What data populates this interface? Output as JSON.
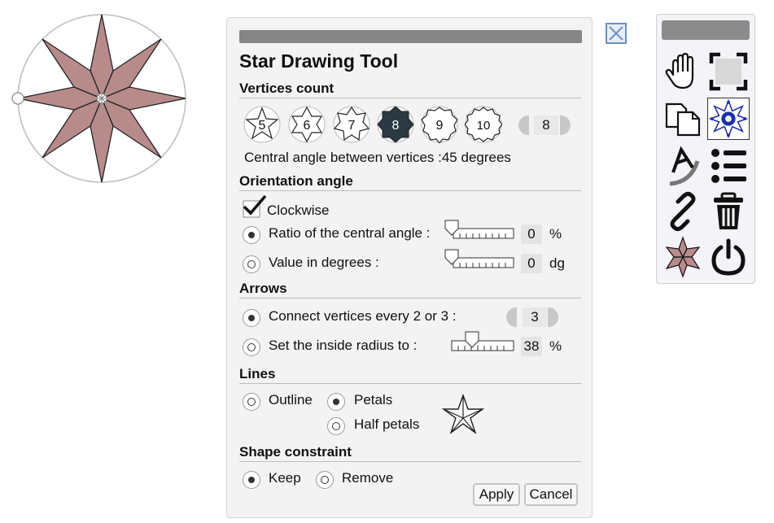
{
  "dialog": {
    "title": "Star Drawing Tool",
    "vertices": {
      "heading": "Vertices count",
      "options": [
        "5",
        "6",
        "7",
        "8",
        "9",
        "10"
      ],
      "selected": "8",
      "spinner_value": "8",
      "central_angle_text": "Central angle between vertices :45 degrees"
    },
    "orientation": {
      "heading": "Orientation angle",
      "clockwise_label": "Clockwise",
      "clockwise_checked": true,
      "ratio_label": "Ratio of the central angle :",
      "ratio_value": "0",
      "ratio_unit": "%",
      "degrees_label": "Value in degrees :",
      "degrees_value": "0",
      "degrees_unit": "dg",
      "selected": "ratio"
    },
    "arrows": {
      "heading": "Arrows",
      "connect_label": "Connect vertices every 2 or 3 :",
      "connect_value": "3",
      "radius_label": "Set the inside radius to :",
      "radius_value": "38",
      "radius_unit": "%",
      "selected": "connect"
    },
    "lines": {
      "heading": "Lines",
      "outline_label": "Outline",
      "petals_label": "Petals",
      "half_petals_label": "Half petals",
      "selected": "petals"
    },
    "constraint": {
      "heading": "Shape constraint",
      "keep_label": "Keep",
      "remove_label": "Remove",
      "selected": "keep"
    },
    "apply_label": "Apply",
    "cancel_label": "Cancel"
  },
  "toolbar": {
    "icons": [
      "hand-icon",
      "fullscreen-icon",
      "copy-icon",
      "star-tool-icon",
      "text-arc-icon",
      "list-icon",
      "link-icon",
      "trash-icon",
      "star-shape-icon",
      "power-icon"
    ],
    "selected": "star-tool-icon"
  },
  "colors": {
    "star_fill": "#b88b8b",
    "selected_vertex": "#2b3a42",
    "accent_blue": "#1c2fa8"
  }
}
